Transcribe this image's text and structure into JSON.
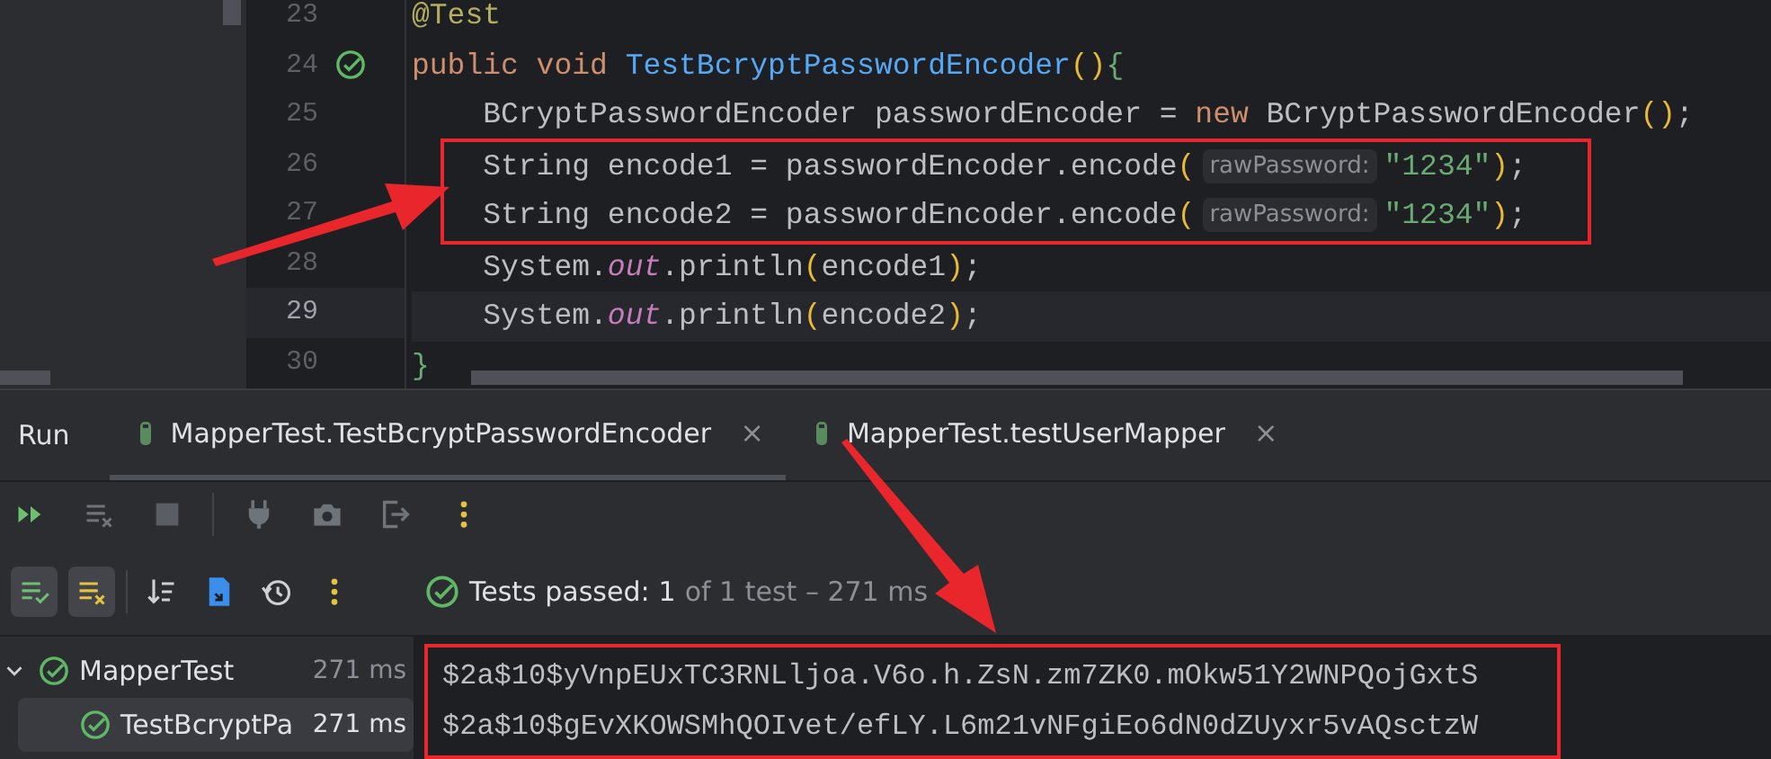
{
  "editor": {
    "lines": [
      {
        "number": "23",
        "current": false,
        "boxed": false,
        "run_marker": false,
        "tokens": [
          {
            "kind": "annot",
            "text": "@Test"
          }
        ]
      },
      {
        "number": "24",
        "current": false,
        "boxed": false,
        "run_marker": true,
        "tokens": [
          {
            "kind": "kw",
            "text": "public void "
          },
          {
            "kind": "fn",
            "text": "TestBcryptPasswordEncoder"
          },
          {
            "kind": "paren",
            "text": "()"
          },
          {
            "kind": "brace",
            "text": "{"
          }
        ]
      },
      {
        "number": "25",
        "current": false,
        "boxed": false,
        "run_marker": false,
        "tokens": [
          {
            "kind": "plain",
            "text": "    BCryptPasswordEncoder passwordEncoder = "
          },
          {
            "kind": "kw",
            "text": "new "
          },
          {
            "kind": "plain",
            "text": "BCryptPasswordEncoder"
          },
          {
            "kind": "paren",
            "text": "()"
          },
          {
            "kind": "plain",
            "text": ";"
          }
        ]
      },
      {
        "number": "26",
        "current": false,
        "boxed": true,
        "run_marker": false,
        "tokens": [
          {
            "kind": "plain",
            "text": "    String encode1 = passwordEncoder.encode"
          },
          {
            "kind": "paren",
            "text": "("
          },
          {
            "kind": "hint",
            "text": "rawPassword:"
          },
          {
            "kind": "str",
            "text": "\"1234\""
          },
          {
            "kind": "paren",
            "text": ")"
          },
          {
            "kind": "plain",
            "text": ";"
          }
        ]
      },
      {
        "number": "27",
        "current": false,
        "boxed": true,
        "run_marker": false,
        "tokens": [
          {
            "kind": "plain",
            "text": "    String encode2 = passwordEncoder.encode"
          },
          {
            "kind": "paren",
            "text": "("
          },
          {
            "kind": "hint",
            "text": "rawPassword:"
          },
          {
            "kind": "str",
            "text": "\"1234\""
          },
          {
            "kind": "paren",
            "text": ")"
          },
          {
            "kind": "plain",
            "text": ";"
          }
        ]
      },
      {
        "number": "28",
        "current": false,
        "boxed": false,
        "run_marker": false,
        "tokens": [
          {
            "kind": "plain",
            "text": "    System."
          },
          {
            "kind": "field",
            "text": "out"
          },
          {
            "kind": "plain",
            "text": ".println"
          },
          {
            "kind": "paren",
            "text": "("
          },
          {
            "kind": "plain",
            "text": "encode1"
          },
          {
            "kind": "paren",
            "text": ")"
          },
          {
            "kind": "plain",
            "text": ";"
          }
        ]
      },
      {
        "number": "29",
        "current": true,
        "boxed": false,
        "run_marker": false,
        "tokens": [
          {
            "kind": "plain",
            "text": "    System."
          },
          {
            "kind": "field",
            "text": "out"
          },
          {
            "kind": "plain",
            "text": ".println"
          },
          {
            "kind": "paren",
            "text": "("
          },
          {
            "kind": "plain",
            "text": "encode2"
          },
          {
            "kind": "paren",
            "text": ")"
          },
          {
            "kind": "plain",
            "text": ";"
          }
        ]
      },
      {
        "number": "30",
        "current": false,
        "boxed": false,
        "run_marker": false,
        "tokens": [
          {
            "kind": "brace",
            "text": "}"
          }
        ]
      }
    ]
  },
  "run_panel": {
    "title": "Run",
    "tabs": [
      {
        "label": "MapperTest.TestBcryptPasswordEncoder",
        "close": "×",
        "selected": true
      },
      {
        "label": "MapperTest.testUserMapper",
        "close": "×",
        "selected": false
      }
    ],
    "status": {
      "label": "Tests passed:",
      "count": "1",
      "detail": "of 1 test – 271 ms"
    },
    "tree": [
      {
        "label": "MapperTest",
        "time": "271 ms",
        "expanded": true,
        "selected": false,
        "children": [
          {
            "label": "TestBcryptPa",
            "time": "271 ms",
            "selected": true
          }
        ]
      }
    ],
    "console": {
      "boxed": true,
      "lines": [
        "$2a$10$yVnpEUxTC3RNLljoa.V6o.h.ZsN.zm7ZK0.mOkw51Y2WNPQojGxtS",
        "$2a$10$gEvXKOWSMhQOIvet/efLY.L6m21vNFgiEo6dN0dZUyxr5vAQsctzW"
      ]
    }
  }
}
